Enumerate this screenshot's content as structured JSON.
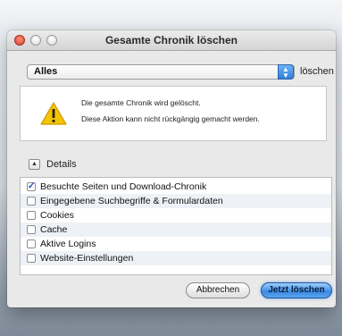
{
  "window": {
    "title": "Gesamte Chronik löschen"
  },
  "range_popup": {
    "selected": "Alles",
    "suffix_label": "löschen"
  },
  "alert": {
    "line1": "Die gesamte Chronik wird gelöscht.",
    "line2": "Diese Aktion kann nicht rückgängig gemacht werden.",
    "icon": "warning-icon"
  },
  "details": {
    "label": "Details",
    "toggle_icon": "triangle-up"
  },
  "items": [
    {
      "label": "Besuchte Seiten und Download-Chronik",
      "checked": true
    },
    {
      "label": "Eingegebene Suchbegriffe & Formulardaten",
      "checked": false
    },
    {
      "label": "Cookies",
      "checked": false
    },
    {
      "label": "Cache",
      "checked": false
    },
    {
      "label": "Aktive Logins",
      "checked": false
    },
    {
      "label": "Website-Einstellungen",
      "checked": false
    }
  ],
  "buttons": {
    "cancel": "Abbrechen",
    "confirm": "Jetzt löschen"
  },
  "colors": {
    "accent": "#3b8ae2",
    "warning": "#f5c400"
  }
}
